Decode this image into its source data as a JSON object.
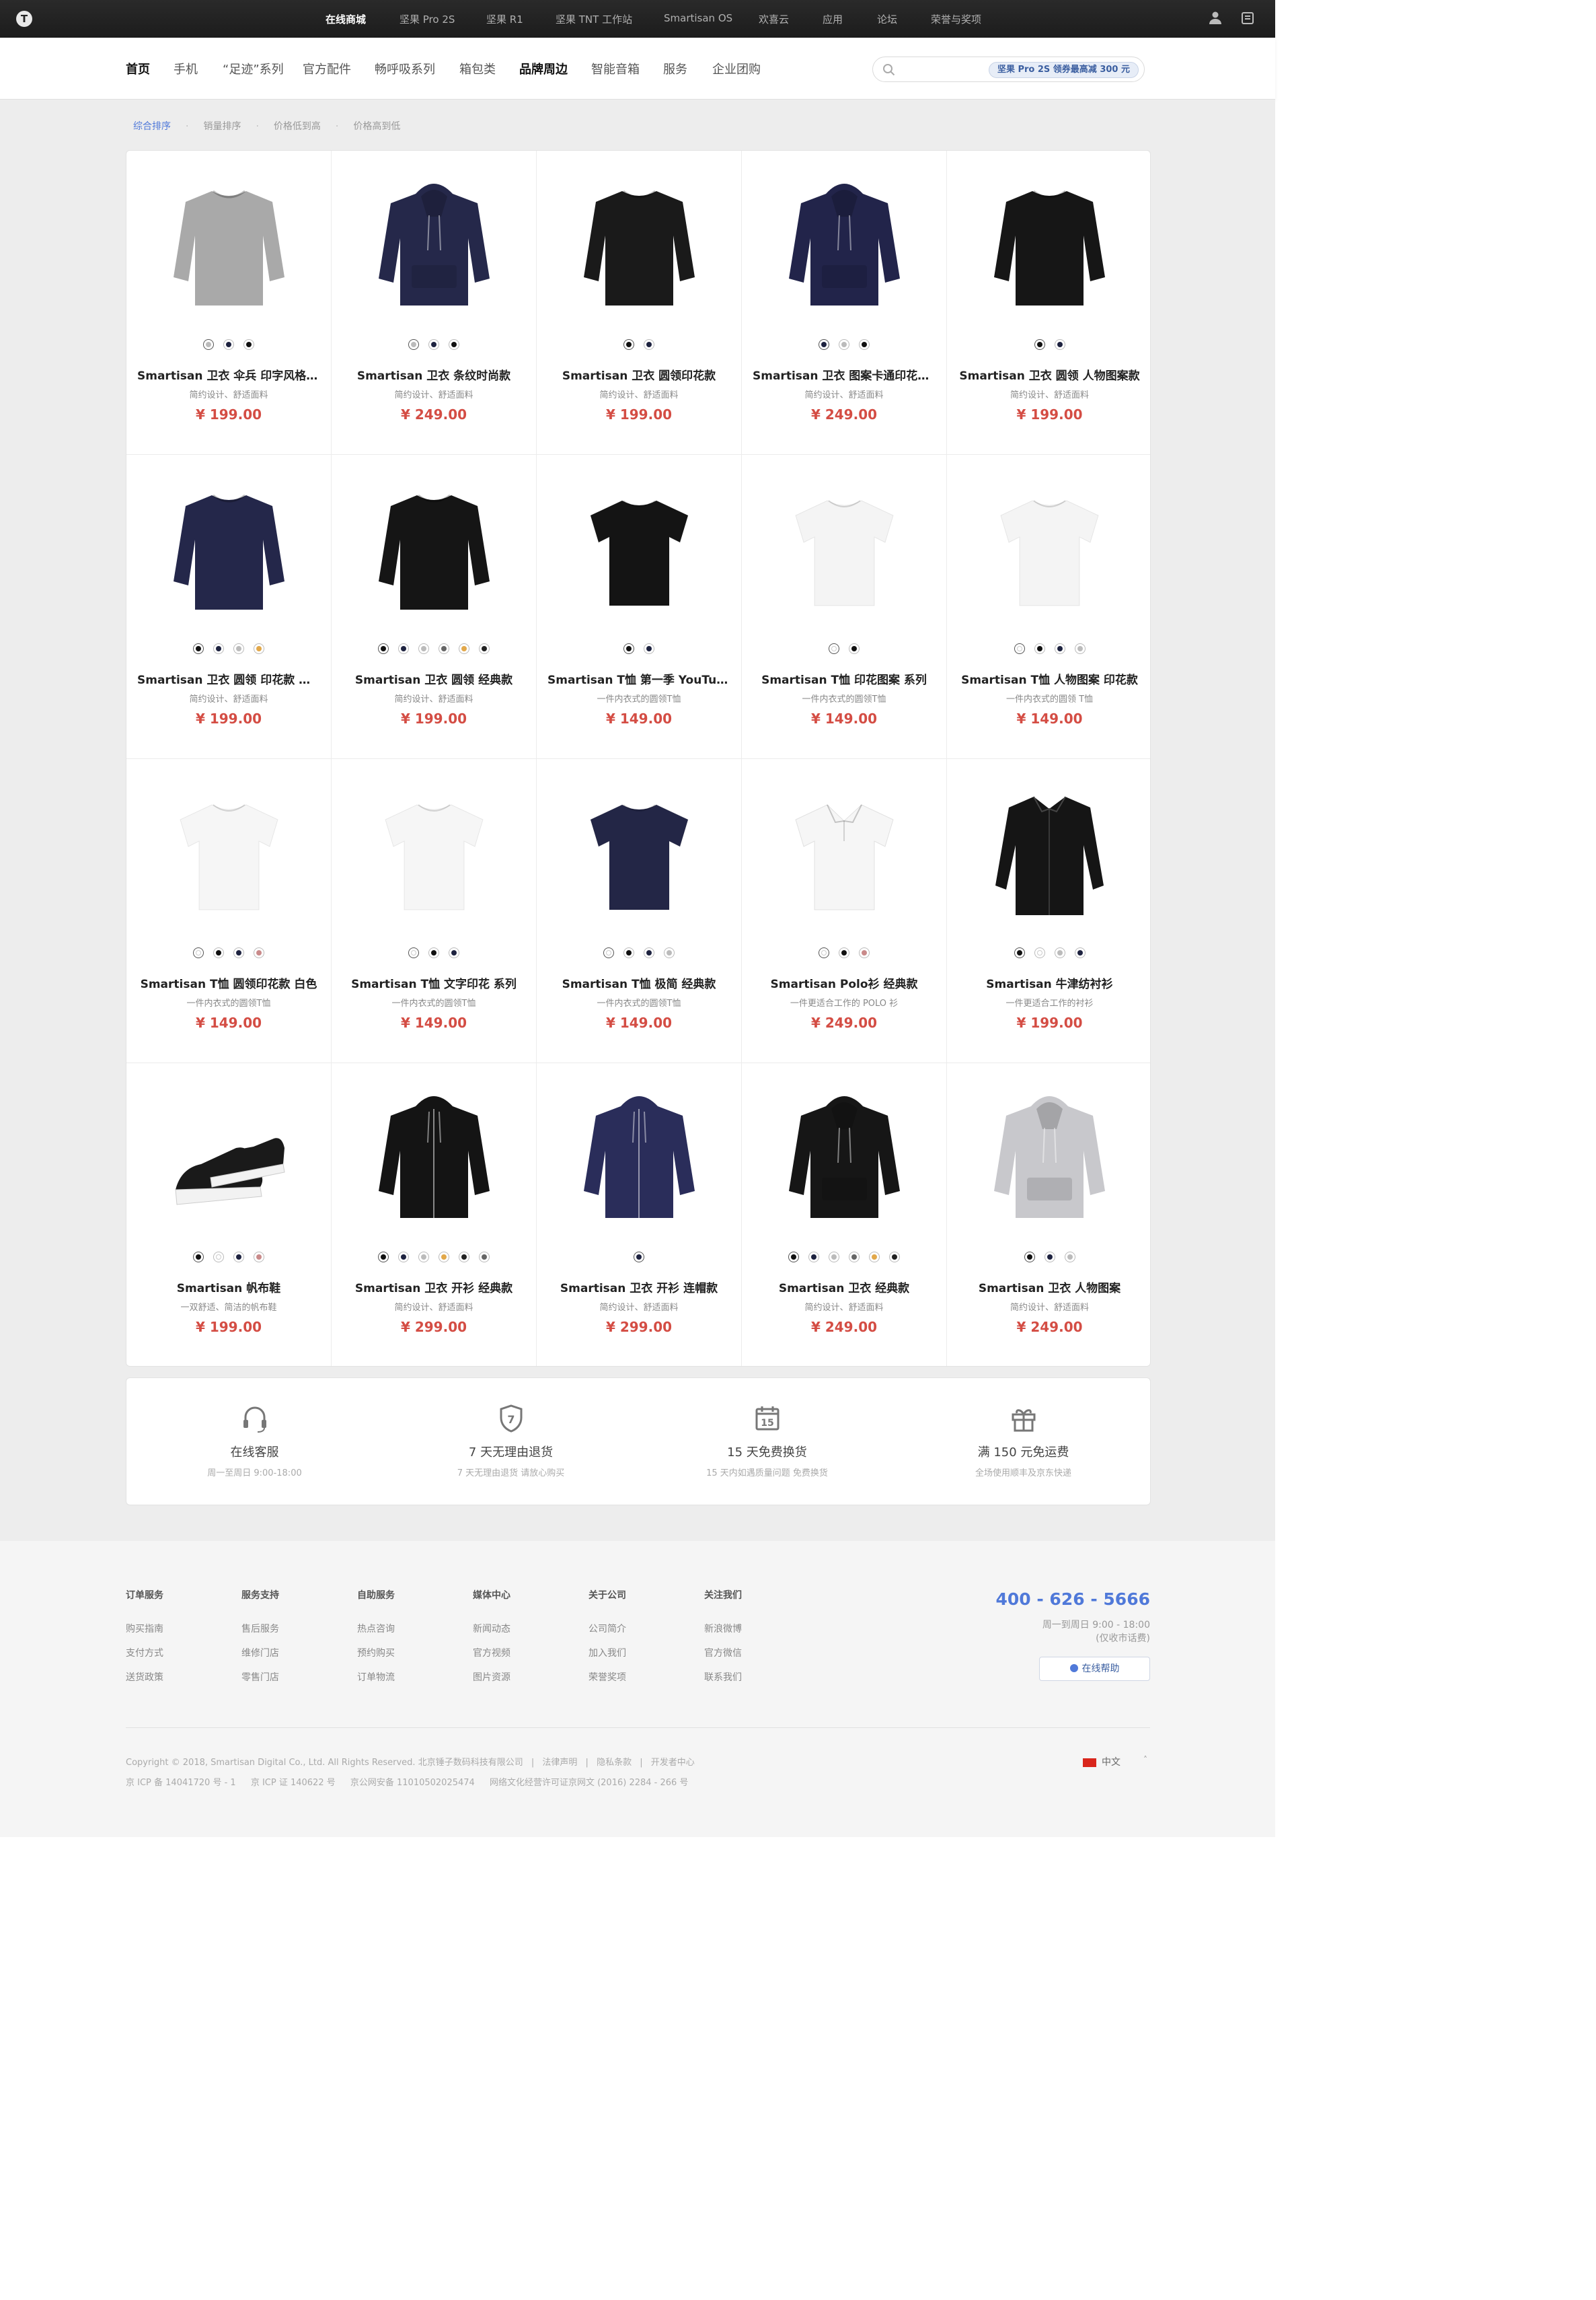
{
  "topbar": {
    "nav": [
      "在线商城",
      "坚果 Pro 2S",
      "坚果 R1",
      "坚果 TNT 工作站",
      "Smartisan OS",
      "欢喜云",
      "应用",
      "论坛",
      "荣誉与奖项"
    ]
  },
  "mainnav": {
    "items": [
      "首页",
      "手机",
      "“足迹”系列",
      "官方配件",
      "畅呼吸系列",
      "箱包类",
      "品牌周边",
      "智能音箱",
      "服务",
      "企业团购"
    ],
    "search_tag": "坚果 Pro 2S 领券最高减 300 元"
  },
  "sort": [
    "综合排序",
    "销量排序",
    "价格低到高",
    "价格高到低"
  ],
  "products": [
    {
      "name": "Smartisan 卫衣 ­伞兵 印字风格主题",
      "desc": "简约设计、舒适面料",
      "price": "¥ 199.00",
      "img": "sweater",
      "color": "#a9a9a9",
      "swatches": [
        "#bbbbbb",
        "#1e2340",
        "#111111"
      ]
    },
    {
      "name": "Smartisan 卫衣 条纹时尚款",
      "desc": "简约设计、舒适面料",
      "price": "¥ 249.00",
      "img": "hoodie",
      "color": "#25284a",
      "swatches": [
        "#bbbbbb",
        "#1e2340",
        "#111111"
      ]
    },
    {
      "name": "Smartisan 卫衣 圆领印花款",
      "desc": "简约设计、舒适面料",
      "price": "¥ 199.00",
      "img": "sweater",
      "color": "#1a1a1a",
      "swatches": [
        "#111111",
        "#1e2340"
      ]
    },
    {
      "name": "Smartisan 卫衣 图案卡通印花连帽款",
      "desc": "简约设计、舒适面料",
      "price": "¥ 249.00",
      "img": "hoodie",
      "color": "#22244a",
      "swatches": [
        "#1e2340",
        "#bbbbbb",
        "#111111"
      ]
    },
    {
      "name": "Smartisan 卫衣 圆领 人物图案款",
      "desc": "简约设计、舒适面料",
      "price": "¥ 199.00",
      "img": "sweater",
      "color": "#161616",
      "swatches": [
        "#111111",
        "#1e2340"
      ]
    },
    {
      "name": "Smartisan 卫衣 圆领 印花款 系列",
      "desc": "简约设计、舒适面料",
      "price": "¥ 199.00",
      "img": "sweater",
      "color": "#24274a",
      "swatches": [
        "#111111",
        "#1e2340",
        "#bbbbbb",
        "#e2a84a"
      ]
    },
    {
      "name": "Smartisan 卫衣 圆领 经典款",
      "desc": "简约设计、舒适面料",
      "price": "¥ 199.00",
      "img": "sweater",
      "color": "#151515",
      "swatches": [
        "#111111",
        "#1e2340",
        "#bbbbbb",
        "#666666",
        "#e2a84a",
        "#222222"
      ]
    },
    {
      "name": "Smartisan T恤 第一季 YouTube 图案款",
      "desc": "一件内衣式的圆领T恤",
      "price": "¥ 149.00",
      "img": "tshirt",
      "color": "#141414",
      "swatches": [
        "#111111",
        "#1e2340"
      ]
    },
    {
      "name": "Smartisan T恤 印花图案 系列",
      "desc": "一件内衣式的圆领T恤",
      "price": "¥ 149.00",
      "img": "tshirt",
      "color": "#f4f4f4",
      "swatches": [
        "#ffffff",
        "#111111"
      ]
    },
    {
      "name": "Smartisan T恤 人物图案 印花款",
      "desc": "一件内衣式的圆领 T恤",
      "price": "¥ 149.00",
      "img": "tshirt",
      "color": "#f4f4f4",
      "swatches": [
        "#ffffff",
        "#111111",
        "#1e2340",
        "#bbbbbb"
      ]
    },
    {
      "name": "Smartisan T恤 圆领印花款 白色",
      "desc": "一件内衣式的圆领T恤",
      "price": "¥ 149.00",
      "img": "tshirt",
      "color": "#f6f6f6",
      "swatches": [
        "#ffffff",
        "#111111",
        "#1e2340",
        "#c98a8a"
      ]
    },
    {
      "name": "Smartisan T恤 文字印花 系列",
      "desc": "一件内衣式的圆领T恤",
      "price": "¥ 149.00",
      "img": "tshirt",
      "color": "#f6f6f6",
      "swatches": [
        "#ffffff",
        "#111111",
        "#1e2340"
      ]
    },
    {
      "name": "Smartisan T恤 极简 经典款",
      "desc": "一件内衣式的圆领T恤",
      "price": "¥ 149.00",
      "img": "tshirt",
      "color": "#232646",
      "swatches": [
        "#ffffff",
        "#111111",
        "#1e2340",
        "#bbbbbb"
      ]
    },
    {
      "name": "Smartisan Polo衫 经典款",
      "desc": "一件更适合工作的 POLO 衫",
      "price": "¥ 249.00",
      "img": "polo",
      "color": "#f6f6f6",
      "swatches": [
        "#ffffff",
        "#111111",
        "#c98a8a"
      ]
    },
    {
      "name": "Smartisan 牛津纺衬衫",
      "desc": "一件更适合工作的衬衫",
      "price": "¥ 199.00",
      "img": "shirt",
      "color": "#151515",
      "swatches": [
        "#111111",
        "#ffffff",
        "#bbbbbb",
        "#1e2340"
      ]
    },
    {
      "name": "Smartisan 帆布鞋",
      "desc": "一双舒适、简洁的帆布鞋",
      "price": "¥ 199.00",
      "img": "shoes",
      "color": "#1a1a1a",
      "swatches": [
        "#111111",
        "#ffffff",
        "#1e2340",
        "#c98a8a"
      ]
    },
    {
      "name": "Smartisan 卫衣 开衫 经典款",
      "desc": "简约设计、舒适面料",
      "price": "¥ 299.00",
      "img": "zipper",
      "color": "#141414",
      "swatches": [
        "#111111",
        "#1e2340",
        "#bbbbbb",
        "#e2a84a",
        "#222222",
        "#666666"
      ]
    },
    {
      "name": "Smartisan 卫衣 开衫 连帽款",
      "desc": "简约设计、舒适面料",
      "price": "¥ 299.00",
      "img": "zipper",
      "color": "#2a2d5a",
      "swatches": [
        "#1e2340"
      ]
    },
    {
      "name": "Smartisan 卫衣 经典款",
      "desc": "简约设计、舒适面料",
      "price": "¥ 249.00",
      "img": "hoodie",
      "color": "#161616",
      "swatches": [
        "#111111",
        "#1e2340",
        "#bbbbbb",
        "#666666",
        "#e2a84a",
        "#222222"
      ]
    },
    {
      "name": "Smartisan 卫衣 人物图案",
      "desc": "简约设计、舒适面料",
      "price": "¥ 249.00",
      "img": "hoodie",
      "color": "#c8c8cc",
      "swatches": [
        "#111111",
        "#1e2340",
        "#bbbbbb"
      ]
    }
  ],
  "services": [
    {
      "title": "在线客服",
      "desc": "周一至周日 9:00-18:00",
      "icon": "headset-icon"
    },
    {
      "title": "7 天无理由退货",
      "desc": "7 天无理由退货 请放心购买",
      "icon": "shield-7-icon"
    },
    {
      "title": "15 天免费换货",
      "desc": "15 天内如遇质量问题 免费换货",
      "icon": "calendar-15-icon"
    },
    {
      "title": "满 150 元免运费",
      "desc": "全场使用顺丰及京东快递",
      "icon": "gift-icon"
    }
  ],
  "footer": {
    "columns": [
      {
        "title": "订单服务",
        "items": [
          "购买指南",
          "支付方式",
          "送货政策"
        ]
      },
      {
        "title": "服务支持",
        "items": [
          "售后服务",
          "维修门店",
          "零售门店"
        ]
      },
      {
        "title": "自助服务",
        "items": [
          "热点咨询",
          "预约购买",
          "订单物流"
        ]
      },
      {
        "title": "媒体中心",
        "items": [
          "新闻动态",
          "官方视频",
          "图片资源"
        ]
      },
      {
        "title": "关于公司",
        "items": [
          "公司简介",
          "加入我们",
          "荣誉奖项"
        ]
      },
      {
        "title": "关注我们",
        "items": [
          "新浪微博",
          "官方微信",
          "联系我们"
        ]
      }
    ],
    "phone": "400 - 626 - 5666",
    "hours": "周一到周日 9:00 - 18:00",
    "hours_note": "(仅收市话费)",
    "help_button": "在线帮助",
    "copyright": "Copyright © 2018, Smartisan Digital Co., Ltd. All Rights Reserved. 北京锤子数码科技有限公司",
    "links": [
      "法律声明",
      "隐私条款",
      "开发者中心"
    ],
    "icp": [
      "京 ICP 备 14041720 号 - 1",
      "京 ICP 证 140622 号",
      "京公网安备 11010502025474",
      "网络文化经营许可证京网文 (2016) 2284 - 266 号"
    ],
    "language": "中文"
  }
}
